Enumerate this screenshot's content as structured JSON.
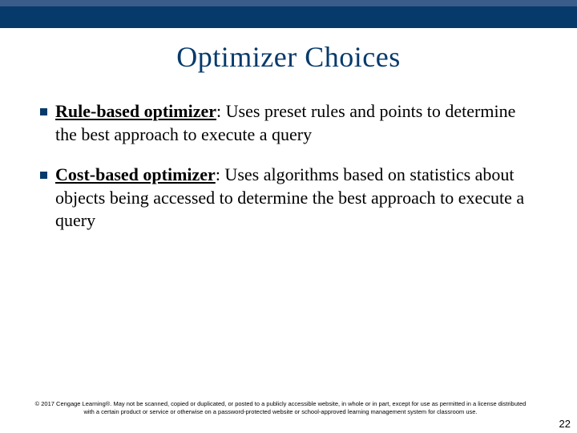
{
  "title": "Optimizer Choices",
  "bullets": [
    {
      "term": "Rule-based optimizer",
      "rest": ": Uses preset rules and points to determine the best approach to execute a query"
    },
    {
      "term": "Cost-based optimizer",
      "rest": ": Uses algorithms based on statistics about objects being accessed to determine the best approach to execute a query"
    }
  ],
  "fineprint": "© 2017 Cengage Learning®. May not be scanned, copied or duplicated, or posted to a publicly accessible website, in whole or in part, except for use as permitted in a license distributed with a certain product or service or otherwise on a password-protected website or school-approved learning management system for classroom use.",
  "page": "22"
}
